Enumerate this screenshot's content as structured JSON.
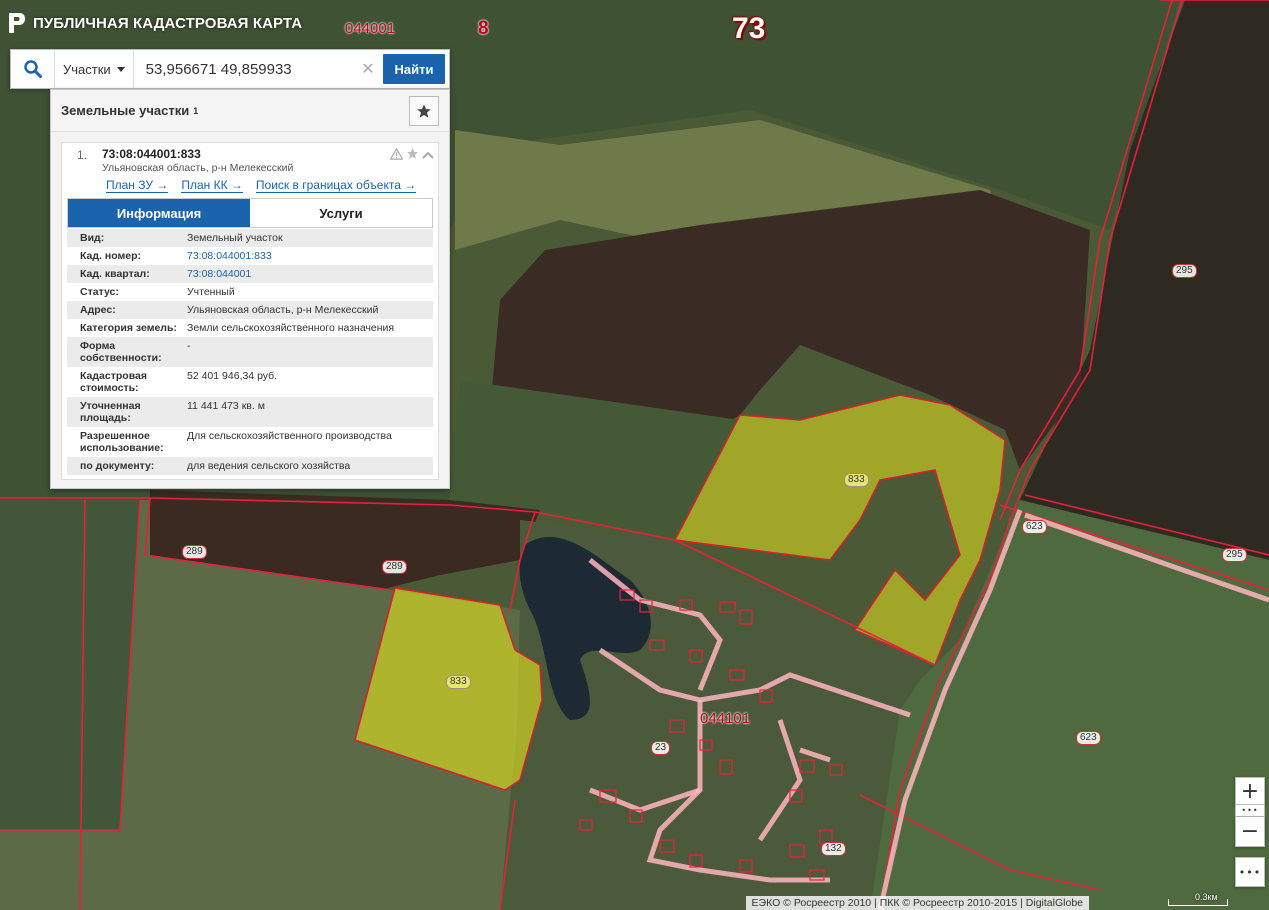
{
  "app": {
    "title": "ПУБЛИЧНАЯ КАДАСТРОВАЯ КАРТА"
  },
  "search": {
    "type_label": "Участки",
    "query": "53,956671 49,859933",
    "find_label": "Найти"
  },
  "panel": {
    "title": "Земельные участки",
    "count": "1",
    "result": {
      "index": "1.",
      "number": "73:08:044001:833",
      "address": "Ульяновская область, р-н Мелекесский",
      "links": [
        "План ЗУ →",
        "План КК →",
        "Поиск в границах объекта →"
      ],
      "tabs": {
        "info": "Информация",
        "services": "Услуги"
      },
      "rows": [
        {
          "k": "Вид:",
          "v": "Земельный участок"
        },
        {
          "k": "Кад. номер:",
          "v": "73:08:044001:833"
        },
        {
          "k": "Кад. квартал:",
          "v": "73:08:044001"
        },
        {
          "k": "Статус:",
          "v": "Учтенный"
        },
        {
          "k": "Адрес:",
          "v": "Ульяновская область, р-н Мелекесский"
        },
        {
          "k": "Категория земель:",
          "v": "Земли сельскохозяйственного назначения"
        },
        {
          "k": "Форма собственности:",
          "v": "-"
        },
        {
          "k": "Кадастровая стоимость:",
          "v": "52 401 946,34 руб."
        },
        {
          "k": "Уточненная площадь:",
          "v": "11 441 473 кв. м"
        },
        {
          "k": "Разрешенное использование:",
          "v": "Для сельскохозяйственного производства"
        },
        {
          "k": "по документу:",
          "v": "для ведения сельского хозяйства"
        }
      ]
    }
  },
  "map": {
    "labels": {
      "quarter_top": "044001",
      "district": "8",
      "region": "73",
      "quarter_village": "044101",
      "parcel_833": "833",
      "parcel_295": "295",
      "parcel_289": "289",
      "parcel_623": "623",
      "parcel_23": "23",
      "parcel_132": "132"
    },
    "colors": {
      "boundary": "#e8203a",
      "selected_fill": "#e6e61e",
      "road": "#ffb6c1"
    }
  },
  "controls": {
    "zoom_in": "+",
    "zoom_dots": "•••",
    "zoom_out": "−",
    "more": "•••"
  },
  "footer": {
    "attribution": "ЕЭКО © Росреестр 2010 | ПКК © Росреестр 2010-2015 | DigitalGlobe",
    "scale": "0.3км"
  }
}
